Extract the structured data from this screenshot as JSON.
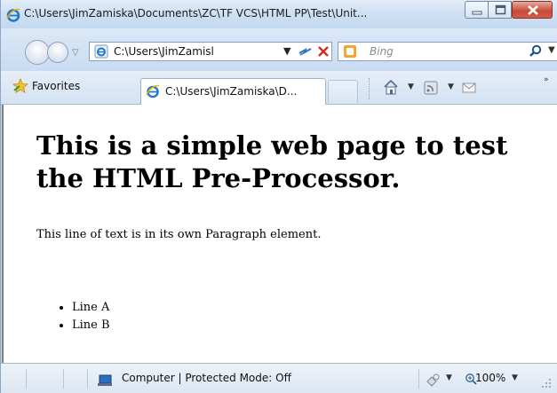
{
  "window": {
    "title": "C:\\Users\\JimZamiska\\Documents\\ZC\\TF VCS\\HTML PP\\Test\\Unit...",
    "minimize_icon": "minimize-icon",
    "maximize_icon": "maximize-icon",
    "close_icon": "close-icon"
  },
  "address_bar": {
    "value": "C:\\Users\\JimZamisl",
    "dropdown": "▼"
  },
  "search": {
    "placeholder": "Bing",
    "dropdown": "▼"
  },
  "nav": {
    "recent_dropdown": "▽"
  },
  "favorites_bar": {
    "favorites_label": "Favorites",
    "tab_label": "C:\\Users\\JimZamiska\\D...",
    "home_dropdown": "▼",
    "feed_dropdown": "▼",
    "more": "»"
  },
  "page": {
    "heading": "This is a simple web page to test the HTML Pre-Processor.",
    "paragraph": "This line of text is in its own Paragraph element.",
    "list_items": [
      "Line A",
      "Line B"
    ]
  },
  "status_bar": {
    "zone_text": "Computer | Protected Mode: Off",
    "addon_dropdown": "▼",
    "zoom": "100%",
    "zoom_dropdown": "▼"
  },
  "colors": {
    "frame": "#cfe0f4",
    "close_button": "#c64a36",
    "bing_accent": "#f4a53a"
  }
}
